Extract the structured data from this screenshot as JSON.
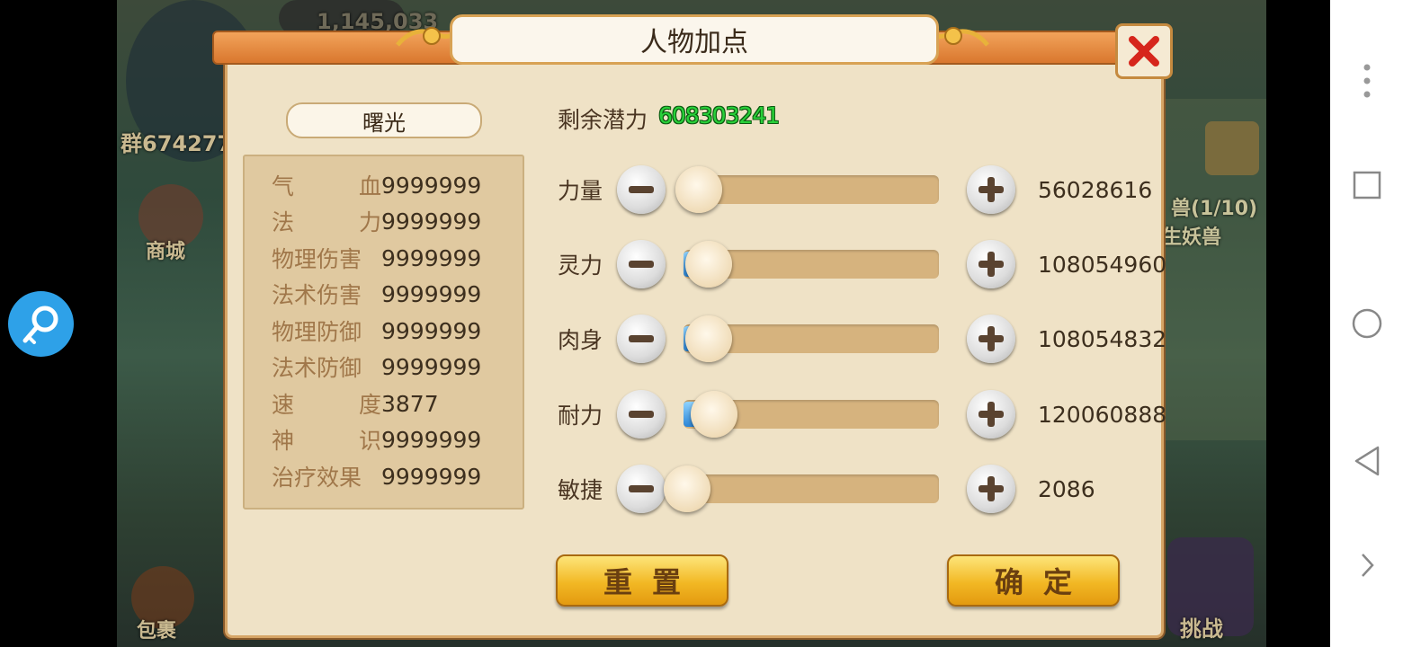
{
  "background": {
    "resource_count": "1,145,033",
    "group_text": "群674277",
    "shop_label": "商城",
    "pet_quest_label": "兽(1/10)",
    "pet_quest_sub": "生妖兽",
    "bag_label": "包裹",
    "challenge_label": "挑战"
  },
  "dialog": {
    "title": "人物加点",
    "character_name": "曙光",
    "potential_label": "剩余潜力",
    "potential_value": "608303241",
    "stats": [
      {
        "label_a": "气",
        "label_b": "血",
        "value": "9999999"
      },
      {
        "label_a": "法",
        "label_b": "力",
        "value": "9999999"
      },
      {
        "label_a": "物理伤害",
        "label_b": "",
        "value": "9999999"
      },
      {
        "label_a": "法术伤害",
        "label_b": "",
        "value": "9999999"
      },
      {
        "label_a": "物理防御",
        "label_b": "",
        "value": "9999999"
      },
      {
        "label_a": "法术防御",
        "label_b": "",
        "value": "9999999"
      },
      {
        "label_a": "速",
        "label_b": "度",
        "value": "3877"
      },
      {
        "label_a": "神",
        "label_b": "识",
        "value": "9999999"
      },
      {
        "label_a": "治疗效果",
        "label_b": "",
        "value": "9999999"
      }
    ],
    "attributes": [
      {
        "label": "力量",
        "value": "56028616",
        "slider_level": 0.06
      },
      {
        "label": "灵力",
        "value": "108054960",
        "slider_level": 0.1
      },
      {
        "label": "肉身",
        "value": "108054832",
        "slider_level": 0.1
      },
      {
        "label": "耐力",
        "value": "120060888",
        "slider_level": 0.12
      },
      {
        "label": "敏捷",
        "value": "2086",
        "slider_level": 0.0
      }
    ],
    "reset_label": "重置",
    "confirm_label": "确定"
  },
  "colors": {
    "potential_green": "#29d03a",
    "gold_button": "#f2b824",
    "panel_bg": "#efe2c6",
    "title_bar": "#e38a3c"
  },
  "icons": {
    "close": "close-x-icon",
    "floating": "magnifier-key-icon",
    "nav_menu": "more-vertical-icon",
    "nav_recent": "square-icon",
    "nav_home": "circle-icon",
    "nav_back": "triangle-back-icon",
    "nav_expand": "chevron-right-icon"
  }
}
